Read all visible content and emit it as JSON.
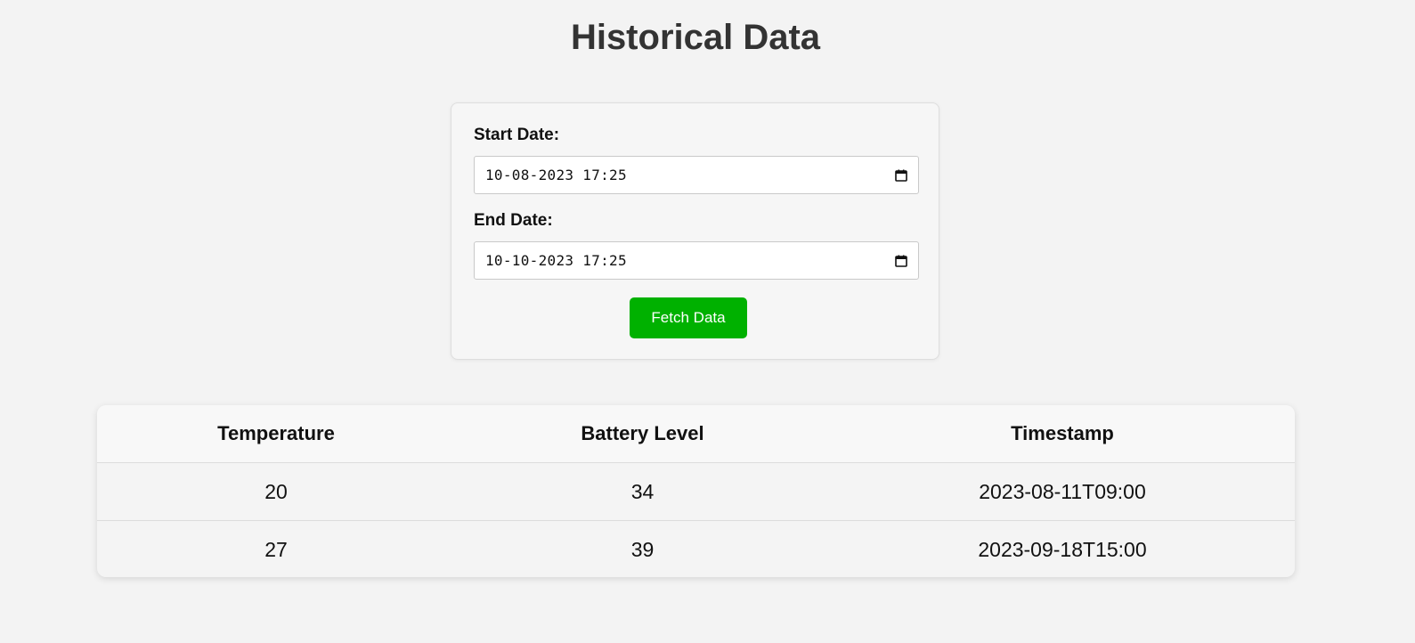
{
  "page": {
    "title": "Historical Data"
  },
  "form": {
    "start_label": "Start Date:",
    "start_value": "10-08-2023 17:25",
    "end_label": "End Date:",
    "end_value": "10-10-2023 17:25",
    "fetch_label": "Fetch Data",
    "fetch_color": "#00b100"
  },
  "icons": {
    "date_picker": "calendar-icon"
  },
  "table": {
    "headers": [
      "Temperature",
      "Battery Level",
      "Timestamp"
    ],
    "rows": [
      [
        "20",
        "34",
        "2023-08-11T09:00"
      ],
      [
        "27",
        "39",
        "2023-09-18T15:00"
      ]
    ]
  }
}
